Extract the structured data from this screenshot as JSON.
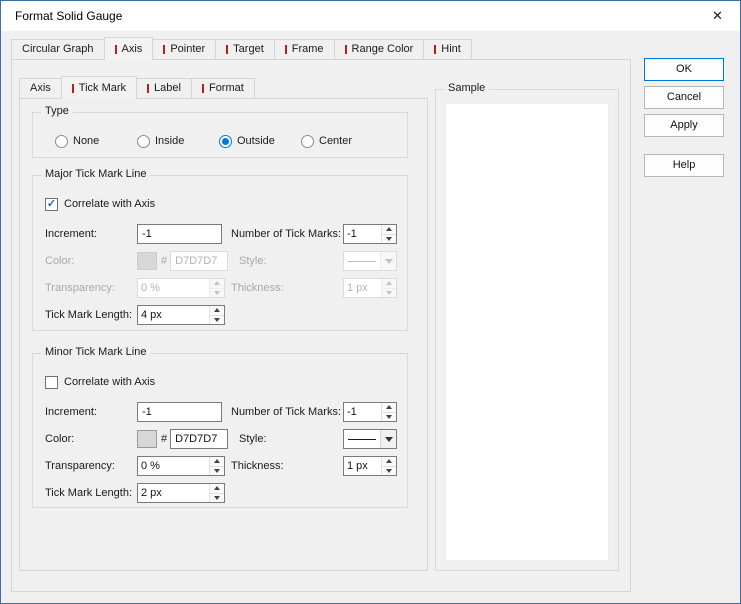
{
  "window": {
    "title": "Format Solid Gauge",
    "close_glyph": "✕"
  },
  "top_tabs": [
    {
      "label": "Circular Graph",
      "active": false
    },
    {
      "label": "Axis",
      "active": true
    },
    {
      "label": "Pointer",
      "active": false
    },
    {
      "label": "Target",
      "active": false
    },
    {
      "label": "Frame",
      "active": false
    },
    {
      "label": "Range Color",
      "active": false
    },
    {
      "label": "Hint",
      "active": false
    }
  ],
  "inner_tabs": [
    {
      "label": "Axis",
      "active": false
    },
    {
      "label": "Tick Mark",
      "active": true
    },
    {
      "label": "Label",
      "active": false
    },
    {
      "label": "Format",
      "active": false
    }
  ],
  "action_buttons": {
    "ok": "OK",
    "cancel": "Cancel",
    "apply": "Apply",
    "help": "Help"
  },
  "type_group": {
    "title": "Type",
    "options": [
      {
        "label": "None",
        "selected": false
      },
      {
        "label": "Inside",
        "selected": false
      },
      {
        "label": "Outside",
        "selected": true
      },
      {
        "label": "Center",
        "selected": false
      }
    ]
  },
  "major": {
    "title": "Major Tick Mark Line",
    "correlate": {
      "label": "Correlate with Axis",
      "checked": true,
      "check_glyph": "✓"
    },
    "increment": {
      "label": "Increment:",
      "value": "-1"
    },
    "num_ticks": {
      "label": "Number of Tick Marks:",
      "value": "-1"
    },
    "color": {
      "label": "Color:",
      "hash": "#",
      "value": "D7D7D7",
      "swatch_style": "background:#d7d7d7",
      "disabled": true
    },
    "style": {
      "label": "Style:",
      "disabled": true
    },
    "transparency": {
      "label": "Transparency:",
      "value": "0 %",
      "disabled": true
    },
    "thickness": {
      "label": "Thickness:",
      "value": "1 px",
      "disabled": true
    },
    "tick_length": {
      "label": "Tick Mark Length:",
      "value": "4 px"
    }
  },
  "minor": {
    "title": "Minor Tick Mark Line",
    "correlate": {
      "label": "Correlate with Axis",
      "checked": false,
      "check_glyph": ""
    },
    "increment": {
      "label": "Increment:",
      "value": "-1"
    },
    "num_ticks": {
      "label": "Number of Tick Marks:",
      "value": "-1"
    },
    "color": {
      "label": "Color:",
      "hash": "#",
      "value": "D7D7D7",
      "swatch_style": "background:#d7d7d7",
      "disabled": false
    },
    "style": {
      "label": "Style:",
      "disabled": false
    },
    "transparency": {
      "label": "Transparency:",
      "value": "0 %",
      "disabled": false
    },
    "thickness": {
      "label": "Thickness:",
      "value": "1 px",
      "disabled": false
    },
    "tick_length": {
      "label": "Tick Mark Length:",
      "value": "2 px"
    }
  },
  "sample": {
    "title": "Sample"
  },
  "colors": {
    "accent": "#0078d7",
    "tab_mark": "#b42020",
    "swatch": "#d7d7d7",
    "disabled_text": "#a8a8a8"
  }
}
